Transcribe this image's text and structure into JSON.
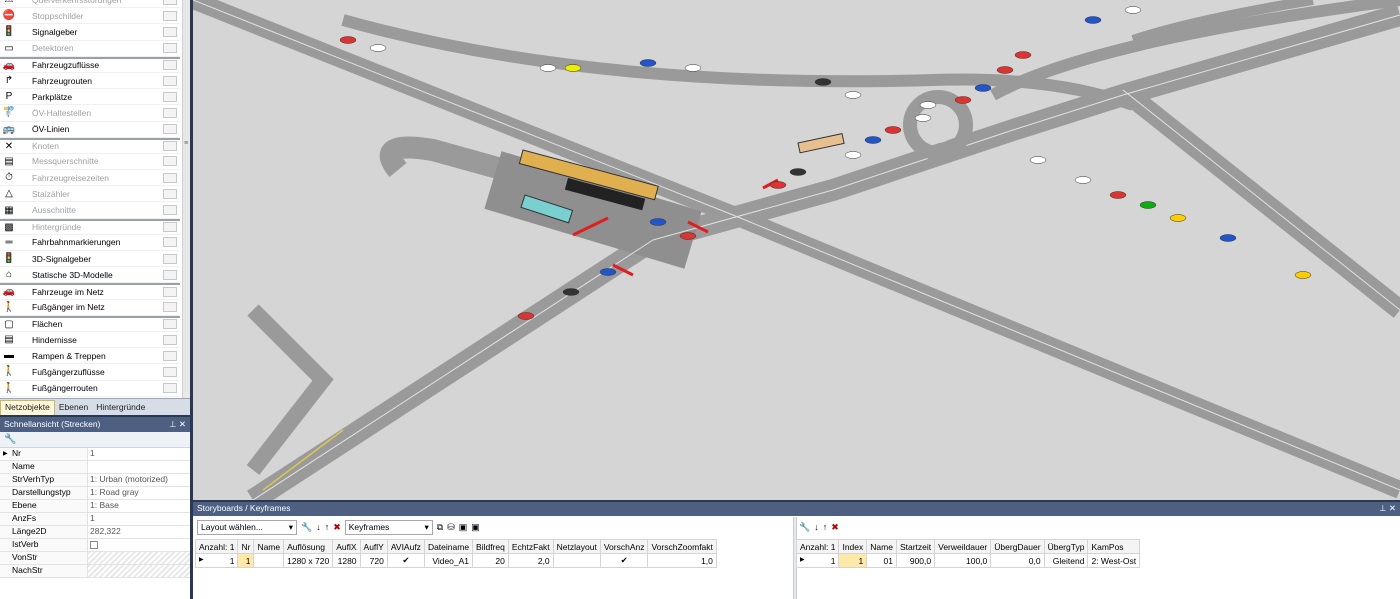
{
  "net_objects": {
    "items": [
      {
        "label": "Querverkehrsstörungen",
        "dim": true,
        "icon": "cross-traffic-icon"
      },
      {
        "label": "Stoppschilder",
        "dim": true,
        "icon": "stop-sign-icon"
      },
      {
        "label": "Signalgeber",
        "dim": false,
        "icon": "traffic-light-icon"
      },
      {
        "label": "Detektoren",
        "dim": true,
        "icon": "detector-icon"
      },
      {
        "label": "Fahrzeugzuflüsse",
        "dim": false,
        "icon": "vehicle-input-icon",
        "group": true
      },
      {
        "label": "Fahrzeugrouten",
        "dim": false,
        "icon": "vehicle-route-icon"
      },
      {
        "label": "Parkplätze",
        "dim": false,
        "icon": "parking-icon"
      },
      {
        "label": "ÖV-Haltestellen",
        "dim": true,
        "icon": "pt-stop-icon"
      },
      {
        "label": "ÖV-Linien",
        "dim": false,
        "icon": "pt-line-icon"
      },
      {
        "label": "Knoten",
        "dim": true,
        "icon": "node-icon",
        "group": true
      },
      {
        "label": "Messquerschnitte",
        "dim": true,
        "icon": "data-collection-icon"
      },
      {
        "label": "Fahrzeugreisezeiten",
        "dim": true,
        "icon": "travel-time-icon"
      },
      {
        "label": "Staizähler",
        "dim": true,
        "icon": "queue-counter-icon"
      },
      {
        "label": "Ausschnitte",
        "dim": true,
        "icon": "section-icon"
      },
      {
        "label": "Hintergründe",
        "dim": true,
        "icon": "background-icon",
        "group": true
      },
      {
        "label": "Fahrbahnmarkierungen",
        "dim": false,
        "icon": "road-marking-icon"
      },
      {
        "label": "3D-Signalgeber",
        "dim": false,
        "icon": "3d-signal-icon"
      },
      {
        "label": "Statische 3D-Modelle",
        "dim": false,
        "icon": "3d-model-icon"
      },
      {
        "label": "Fahrzeuge im Netz",
        "dim": false,
        "icon": "vehicle-icon",
        "group": true
      },
      {
        "label": "Fußgänger im Netz",
        "dim": false,
        "icon": "pedestrian-icon"
      },
      {
        "label": "Flächen",
        "dim": false,
        "icon": "area-icon",
        "group": true
      },
      {
        "label": "Hindernisse",
        "dim": false,
        "icon": "obstacle-icon"
      },
      {
        "label": "Rampen & Treppen",
        "dim": false,
        "icon": "stairs-icon"
      },
      {
        "label": "Fußgängerzuflüsse",
        "dim": false,
        "icon": "pedestrian-input-icon"
      },
      {
        "label": "Fußgängerrouten",
        "dim": false,
        "icon": "pedestrian-route-icon"
      }
    ],
    "tabs": [
      "Netzobjekte",
      "Ebenen",
      "Hintergründe"
    ]
  },
  "quickview": {
    "title": "Schnellansicht (Strecken)",
    "rows": [
      {
        "key": "Nr",
        "value": "1"
      },
      {
        "key": "Name",
        "value": ""
      },
      {
        "key": "StrVerhTyp",
        "value": "1: Urban (motorized)"
      },
      {
        "key": "Darstellungstyp",
        "value": "1: Road gray"
      },
      {
        "key": "Ebene",
        "value": "1: Base"
      },
      {
        "key": "AnzFs",
        "value": "1"
      },
      {
        "key": "Länge2D",
        "value": "282,322"
      },
      {
        "key": "IstVerb",
        "value": ""
      },
      {
        "key": "VonStr",
        "value": ""
      },
      {
        "key": "NachStr",
        "value": ""
      }
    ]
  },
  "storyboards": {
    "title": "Storyboards / Keyframes",
    "layout_combo": "Layout wählen...",
    "keyframes_combo": "Keyframes",
    "left_table": {
      "headers": [
        "Anzahl: 1",
        "Nr",
        "Name",
        "Auflösung",
        "AuflX",
        "AuflY",
        "AVIAufz",
        "Dateiname",
        "Bildfreq",
        "EchtzFakt",
        "Netzlayout",
        "VorschAnz",
        "VorschZoomfakt"
      ],
      "row": [
        "1",
        "1",
        "",
        "1280 x 720",
        "1280",
        "720",
        "",
        "Video_A1",
        "20",
        "2,0",
        "",
        "",
        "1,0"
      ]
    },
    "right_table": {
      "headers": [
        "Anzahl: 1",
        "Index",
        "Name",
        "Startzeit",
        "Verweildauer",
        "ÜbergDauer",
        "ÜbergTyp",
        "KamPos"
      ],
      "row": [
        "1",
        "1",
        "01",
        "900,0",
        "100,0",
        "0,0",
        "Gleitend",
        "2: West-Ost"
      ]
    }
  }
}
